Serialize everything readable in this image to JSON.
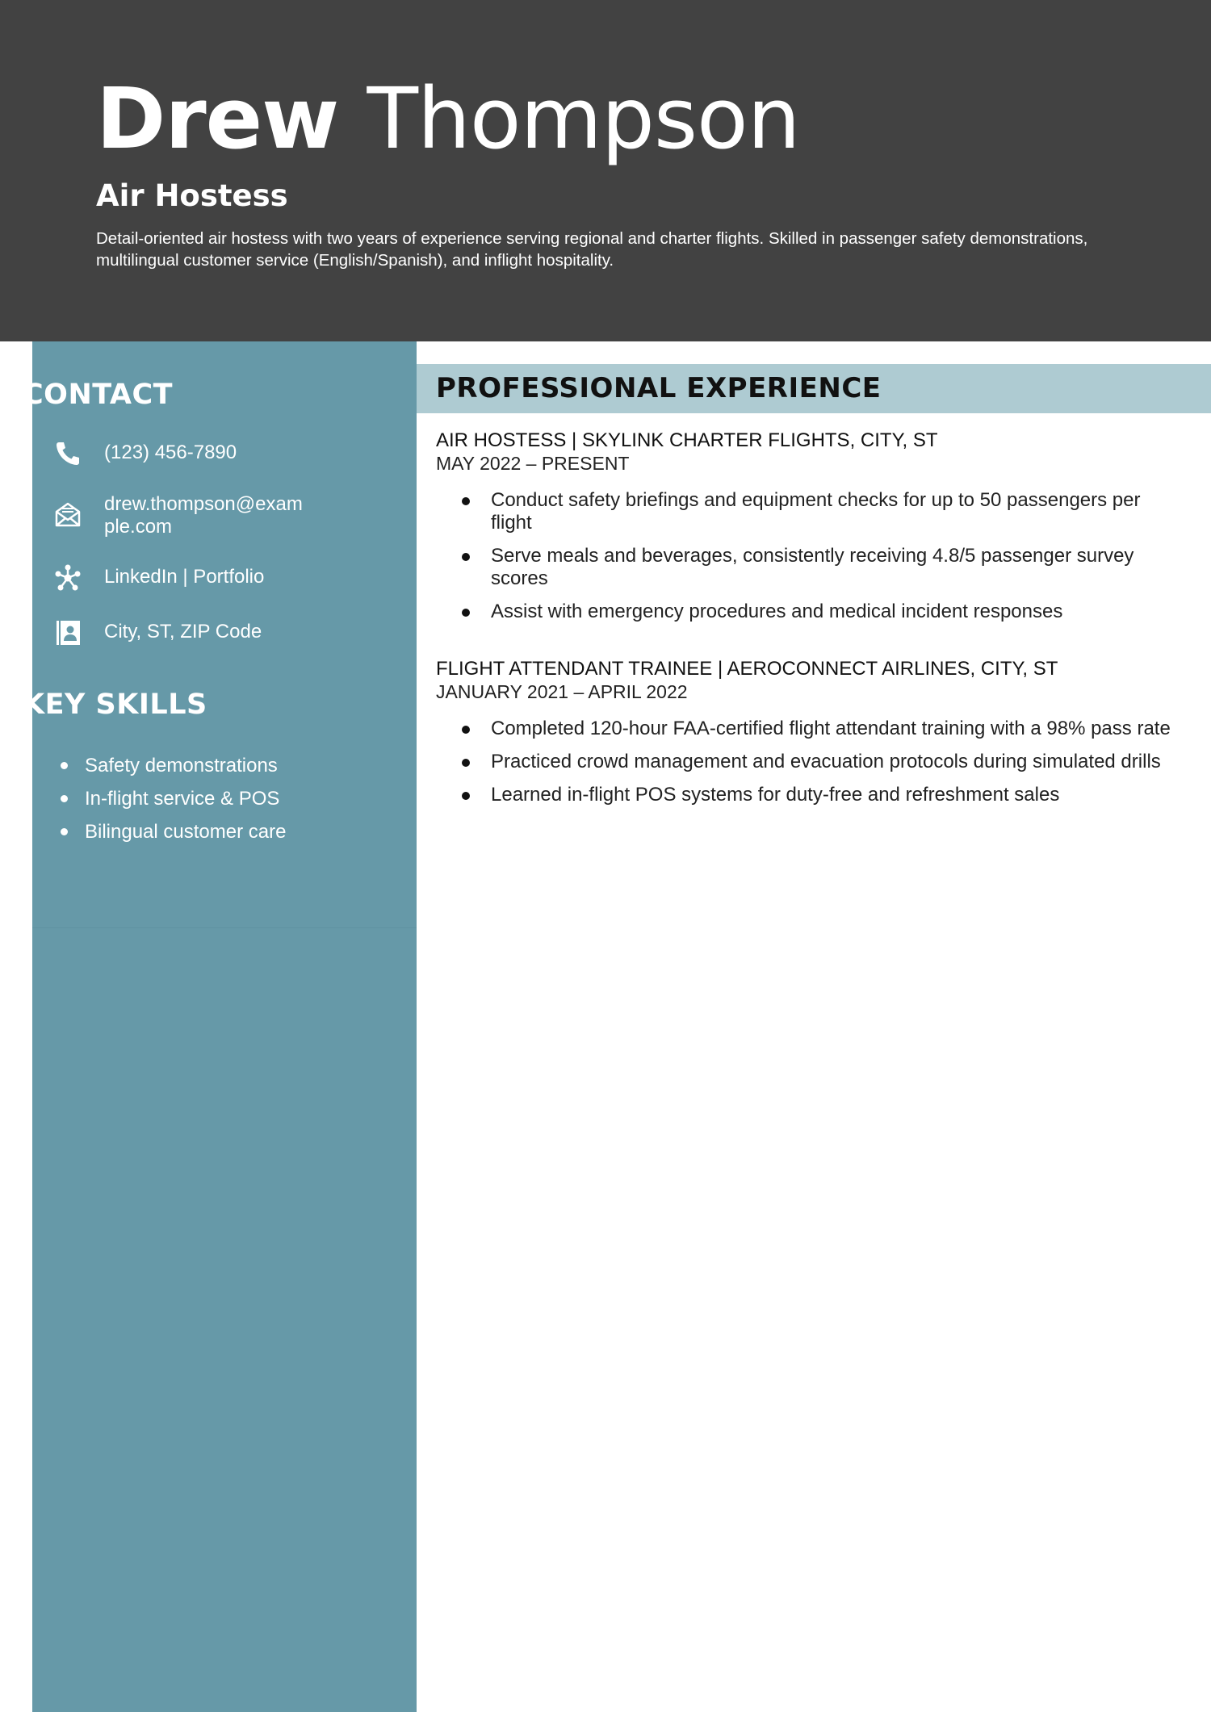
{
  "header": {
    "first_name": "Drew",
    "last_name": "Thompson",
    "job_title": "Air Hostess",
    "summary": "Detail-oriented air hostess with two years of experience serving regional and charter flights. Skilled in passenger safety demonstrations, multilingual customer service (English/Spanish), and inflight hospitality."
  },
  "sidebar": {
    "contact_heading": "CONTACT",
    "contact": {
      "phone": "(123) 456-7890",
      "email": "drew.thompson@example.com",
      "links": "LinkedIn | Portfolio",
      "address": "City, ST, ZIP Code"
    },
    "icons": {
      "phone": "phone-icon",
      "email": "envelope-icon",
      "links": "network-icon",
      "address": "contact-card-icon"
    },
    "skills_heading": "KEY SKILLS",
    "skills": [
      "Safety demonstrations",
      "In-flight service & POS",
      "Bilingual customer care"
    ]
  },
  "experience": {
    "heading": "PROFESSIONAL EXPERIENCE",
    "jobs": [
      {
        "role": "AIR HOSTESS | SKYLINK CHARTER FLIGHTS, CITY, ST",
        "dates": "MAY 2022 – PRESENT",
        "bullets": [
          "Conduct safety briefings and equipment checks for up to 50 passengers per flight",
          "Serve meals and beverages, consistently receiving 4.8/5 passenger survey scores",
          "Assist with emergency procedures and medical incident responses"
        ]
      },
      {
        "role": "FLIGHT ATTENDANT TRAINEE | AEROCONNECT AIRLINES, CITY, ST",
        "dates": "JANUARY 2021 – APRIL 2022",
        "bullets": [
          "Completed 120-hour FAA-certified flight attendant training with a 98% pass rate",
          "Practiced crowd management and evacuation protocols during simulated drills",
          "Learned in-flight POS systems for duty-free and refreshment sales"
        ]
      }
    ]
  },
  "colors": {
    "header_bg": "#424242",
    "sidebar_bg": "#6699a8",
    "section_bar_bg": "#aecbd2",
    "text_light": "#ffffff",
    "text_dark": "#111111"
  }
}
